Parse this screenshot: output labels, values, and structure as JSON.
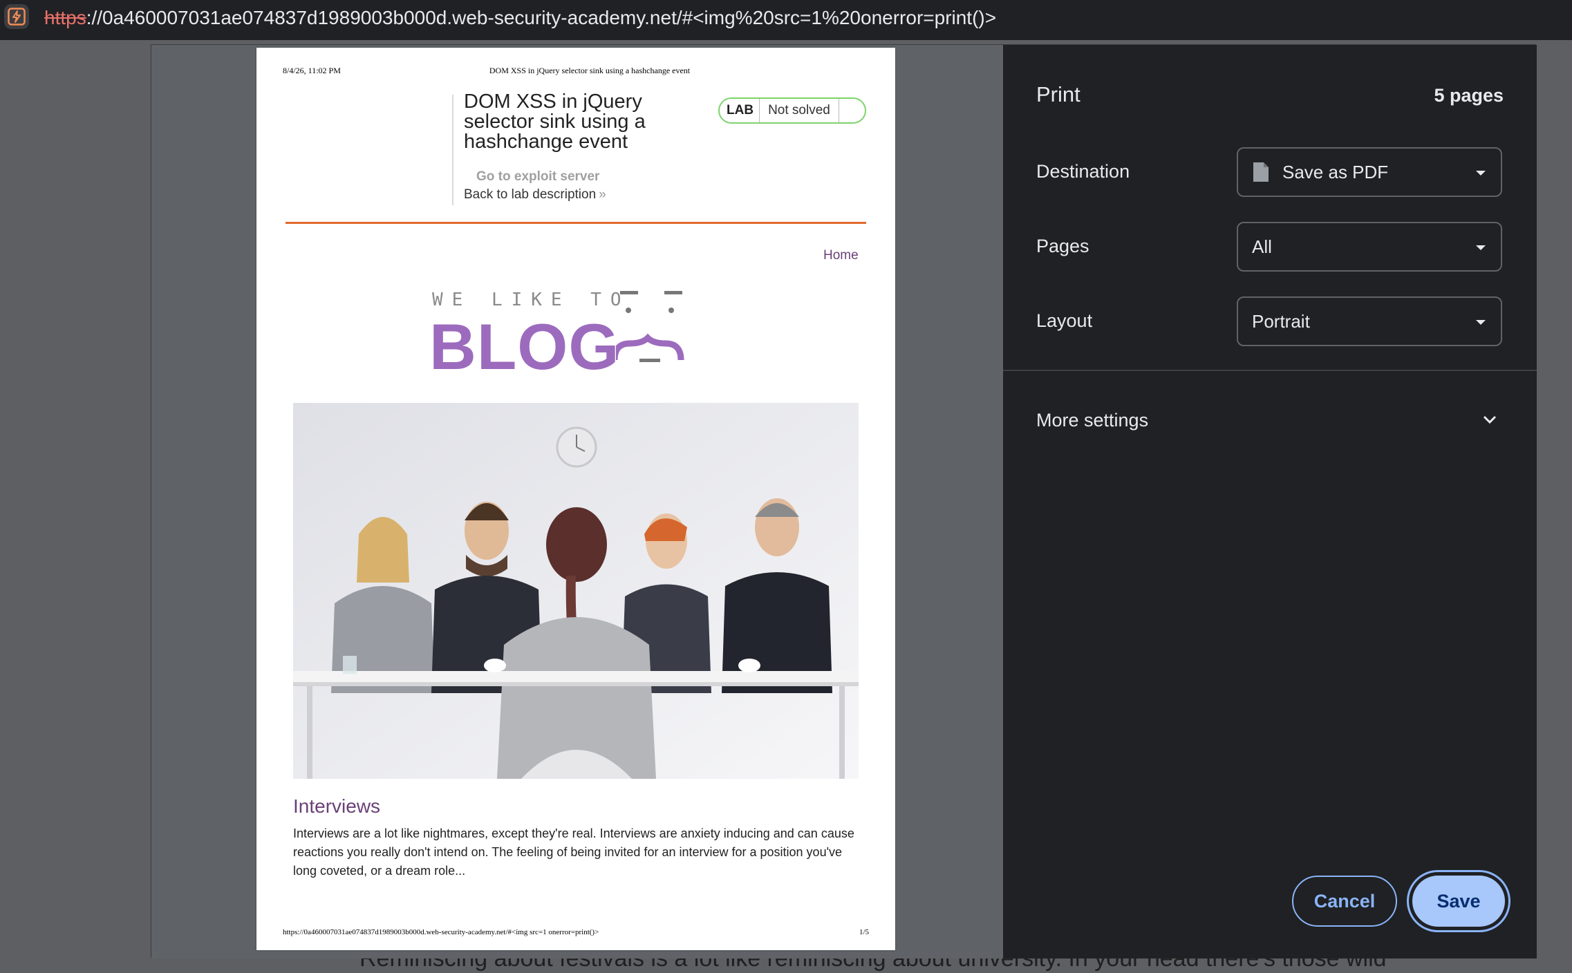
{
  "browser": {
    "url_scheme": "https",
    "url_rest": "://0a460007031ae074837d1989003b000d.web-security-academy.net/#<img%20src=1%20onerror=print()>"
  },
  "background_page": {
    "visible_text": "Reminiscing about festivals is a lot like reminiscing about university. In your head there's those wild"
  },
  "preview": {
    "header_date": "8/4/26, 11:02 PM",
    "header_title": "DOM XSS in jQuery selector sink using a hashchange event",
    "lab_title": "DOM XSS in jQuery selector sink using a hashchange event",
    "lab_badge_label": "LAB",
    "lab_status": "Not solved",
    "exploit_link": "Go to exploit server",
    "back_link": "Back to lab description",
    "back_link_chevron": "»",
    "nav_home": "Home",
    "logo_small": "WE LIKE TO",
    "logo_big": "BLOG",
    "post_title": "Interviews",
    "post_excerpt": "Interviews are a lot like nightmares, except they're real. Interviews are anxiety inducing and can cause reactions you really don't intend on. The feeling of being invited for an interview for a position you've long coveted, or a dream role...",
    "footer_url": "https://0a460007031ae074837d1989003b000d.web-security-academy.net/#<img src=1 onerror=print()>",
    "footer_page": "1/5",
    "accent_orange": "#e2692c",
    "accent_purple": "#9c6bbd"
  },
  "print": {
    "title": "Print",
    "page_count": "5 pages",
    "destination_label": "Destination",
    "destination_value": "Save as PDF",
    "destination_icon": "document-icon",
    "pages_label": "Pages",
    "pages_value": "All",
    "layout_label": "Layout",
    "layout_value": "Portrait",
    "more_settings": "More settings",
    "cancel": "Cancel",
    "save": "Save",
    "accent_blue": "#8ab4f8"
  }
}
